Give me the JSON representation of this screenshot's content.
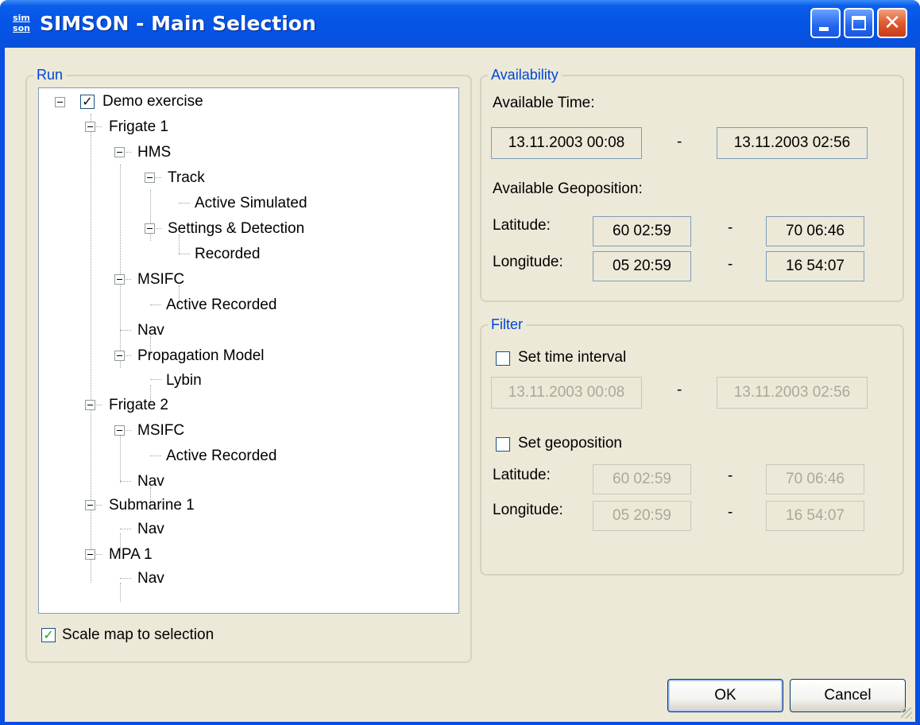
{
  "window": {
    "title": "SIMSON - Main Selection",
    "icon_text_top": "sim",
    "icon_text_bottom": "son",
    "close_glyph": "✕"
  },
  "run": {
    "label": "Run",
    "tree": [
      {
        "label": "Demo exercise",
        "checked": true
      },
      {
        "label": "Frigate 1"
      },
      {
        "label": "HMS"
      },
      {
        "label": "Track"
      },
      {
        "label": "Active Simulated"
      },
      {
        "label": "Settings & Detection"
      },
      {
        "label": "Recorded"
      },
      {
        "label": "MSIFC"
      },
      {
        "label": "Active Recorded"
      },
      {
        "label": "Nav"
      },
      {
        "label": "Propagation Model"
      },
      {
        "label": "Lybin"
      },
      {
        "label": "Frigate 2"
      },
      {
        "label": "MSIFC"
      },
      {
        "label": "Active Recorded"
      },
      {
        "label": "Nav"
      },
      {
        "label": "Submarine 1"
      },
      {
        "label": "Nav"
      },
      {
        "label": "MPA 1"
      },
      {
        "label": "Nav"
      }
    ],
    "scale_map_label": "Scale map to selection",
    "scale_map_checked": true
  },
  "availability": {
    "label": "Availability",
    "time_label": "Available Time:",
    "time_from": "13.11.2003 00:08",
    "time_to": "13.11.2003 02:56",
    "geo_label": "Available Geoposition:",
    "latitude_label": "Latitude:",
    "lat_from": "60 02:59",
    "lat_to": "70 06:46",
    "longitude_label": "Longitude:",
    "lon_from": "05 20:59",
    "lon_to": "16 54:07",
    "dash": "-"
  },
  "filter": {
    "label": "Filter",
    "set_time_label": "Set time interval",
    "time_from": "13.11.2003 00:08",
    "time_to": "13.11.2003 02:56",
    "set_geo_label": "Set geoposition",
    "latitude_label": "Latitude:",
    "lat_from": "60 02:59",
    "lat_to": "70 06:46",
    "longitude_label": "Longitude:",
    "lon_from": "05 20:59",
    "lon_to": "16 54:07",
    "dash": "-"
  },
  "buttons": {
    "ok": "OK",
    "cancel": "Cancel"
  }
}
